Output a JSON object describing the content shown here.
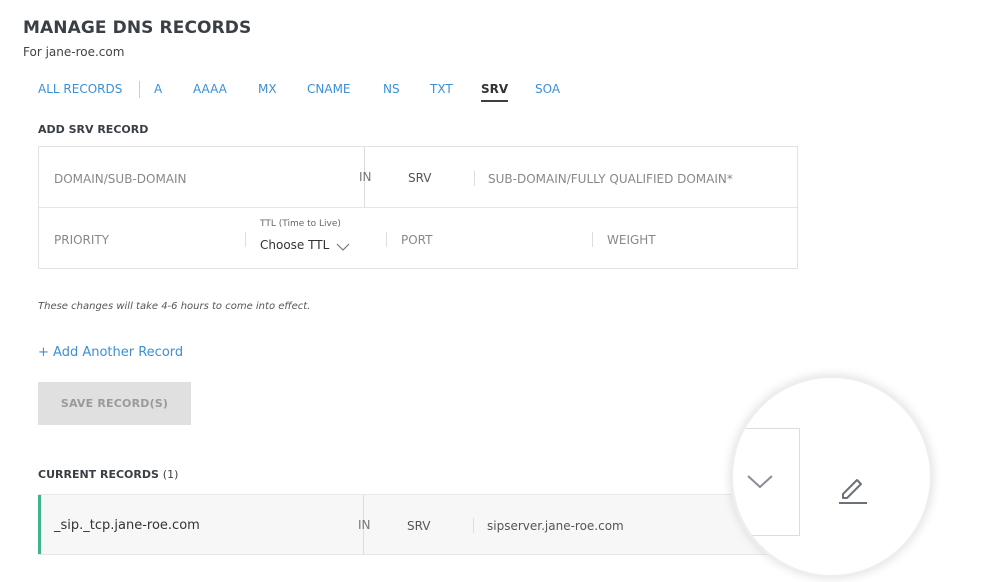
{
  "page": {
    "title": "MANAGE DNS RECORDS",
    "subtitle": "For jane-roe.com"
  },
  "tabs": [
    {
      "label": "ALL RECORDS",
      "active": false
    },
    {
      "label": "A",
      "active": false
    },
    {
      "label": "AAAA",
      "active": false
    },
    {
      "label": "MX",
      "active": false
    },
    {
      "label": "CNAME",
      "active": false
    },
    {
      "label": "NS",
      "active": false
    },
    {
      "label": "TXT",
      "active": false
    },
    {
      "label": "SRV",
      "active": true
    },
    {
      "label": "SOA",
      "active": false
    }
  ],
  "add_section": {
    "title": "ADD SRV RECORD",
    "domain_placeholder": "DOMAIN/SUB-DOMAIN",
    "in_label": "IN",
    "type_label": "SRV",
    "target_placeholder": "SUB-DOMAIN/FULLY QUALIFIED DOMAIN*",
    "priority_placeholder": "PRIORITY",
    "ttl_label": "TTL (Time to Live)",
    "ttl_value": "Choose TTL",
    "port_placeholder": "PORT",
    "weight_placeholder": "WEIGHT"
  },
  "note": "These changes will take 4-6 hours to come into effect.",
  "add_another": "+ Add Another Record",
  "save_button": "SAVE RECORD(S)",
  "current": {
    "title": "CURRENT RECORDS",
    "count": "(1)",
    "records": [
      {
        "host": "_sip._tcp.jane-roe.com",
        "in": "IN",
        "type": "SRV",
        "target": "sipserver.jane-roe.com"
      }
    ]
  },
  "colors": {
    "link": "#3b8fd6",
    "accent_green": "#3fb48a",
    "button_disabled": "#e0e0e0"
  },
  "icons": {
    "expand": "chevron-down-icon",
    "edit": "pencil-edit-icon",
    "ttl_dropdown": "chevron-down-icon"
  }
}
